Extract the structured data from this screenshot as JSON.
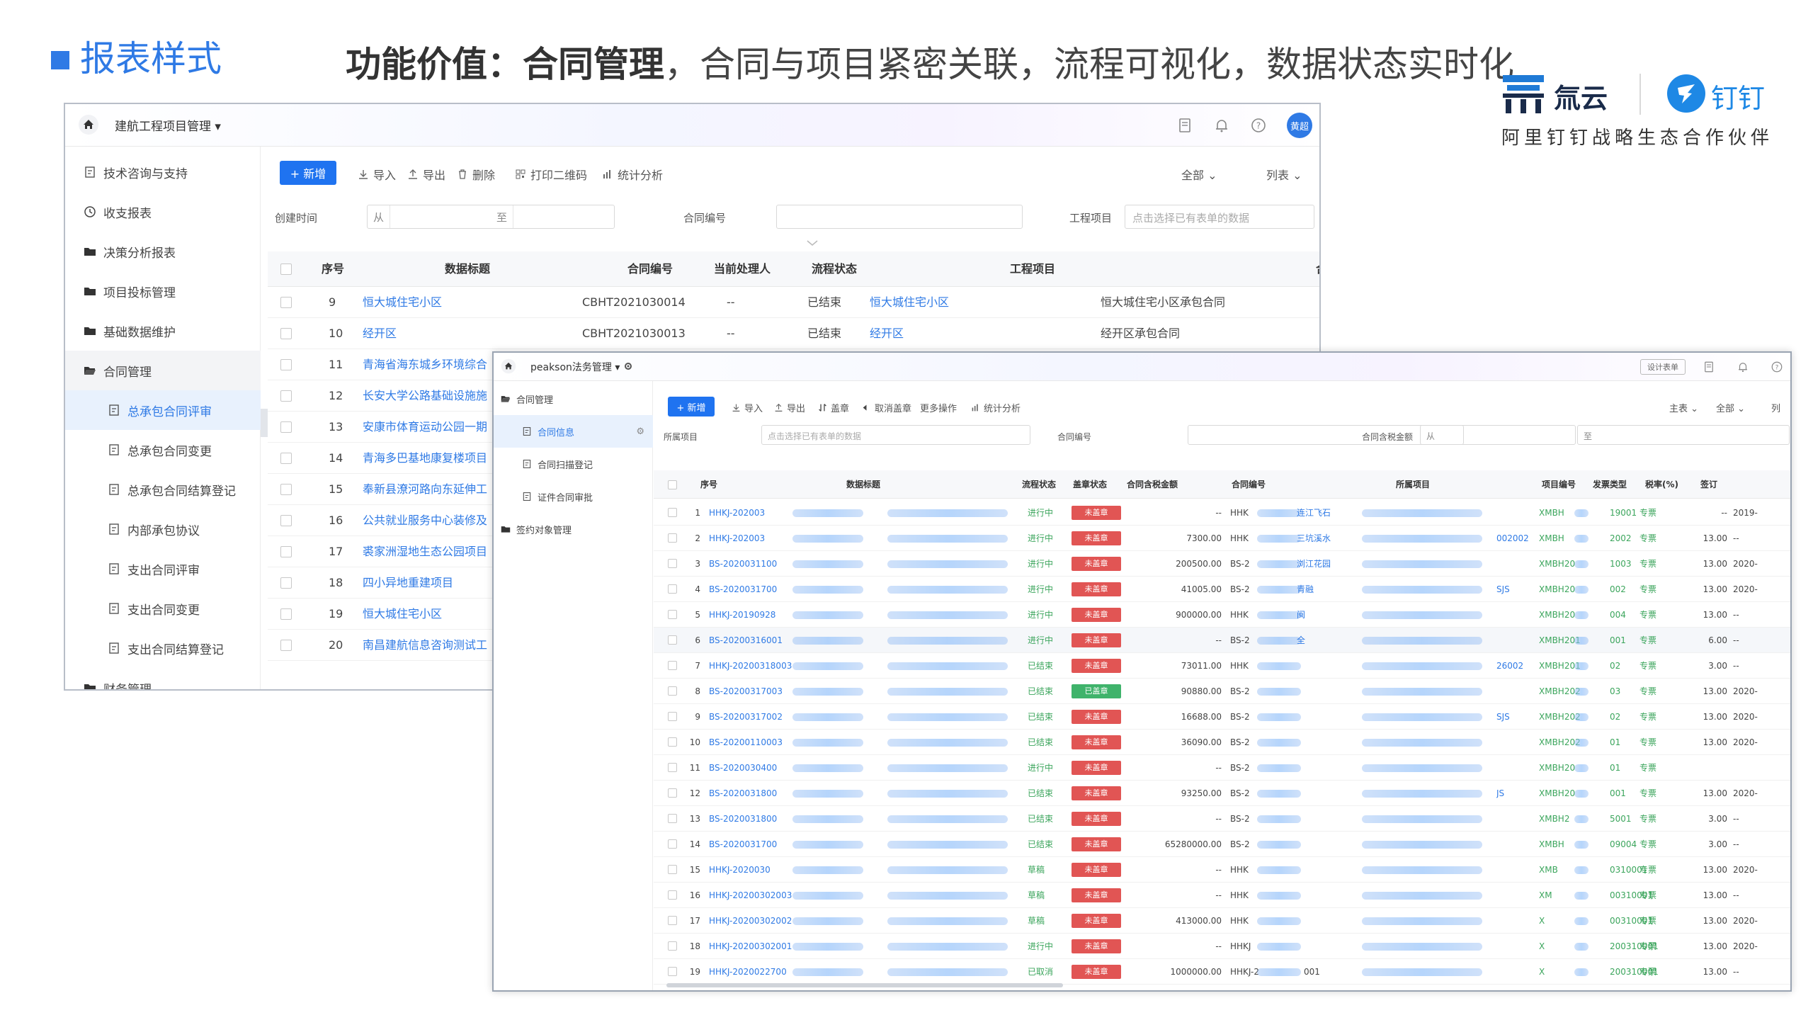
{
  "slide": {
    "title": "报表样式",
    "function_prefix": "功能价值：",
    "function_topic": "合同管理",
    "function_desc": "，合同与项目紧密关联，流程可视化，数据状态实时化",
    "logo_qi": "氚云",
    "logo_ding": "钉钉",
    "partner": "阿里钉钉战略生态合作伙伴",
    "accent_color": "#2f7ae5"
  },
  "win1": {
    "app_title": "建航工程项目管理 ▾",
    "avatar": "黄超",
    "sidebar": [
      {
        "label": "技术咨询与支持",
        "icon": "form-icon"
      },
      {
        "label": "收支报表",
        "icon": "clock-icon"
      },
      {
        "label": "决策分析报表",
        "icon": "folder-icon"
      },
      {
        "label": "项目投标管理",
        "icon": "folder-icon"
      },
      {
        "label": "基础数据维护",
        "icon": "folder-icon"
      },
      {
        "label": "合同管理",
        "icon": "folder-open-icon"
      },
      {
        "label": "总承包合同评审",
        "icon": "form-icon"
      },
      {
        "label": "总承包合同变更",
        "icon": "form-icon"
      },
      {
        "label": "总承包合同结算登记",
        "icon": "form-icon"
      },
      {
        "label": "内部承包协议",
        "icon": "form-icon"
      },
      {
        "label": "支出合同评审",
        "icon": "form-icon"
      },
      {
        "label": "支出合同变更",
        "icon": "form-icon"
      },
      {
        "label": "支出合同结算登记",
        "icon": "form-icon"
      },
      {
        "label": "财务管理",
        "icon": "folder-icon"
      }
    ],
    "toolbar": {
      "add": "+ 新增",
      "import": "导入",
      "export": "导出",
      "delete": "删除",
      "print_qr": "打印二维码",
      "stats": "统计分析",
      "filter_all": "全部 ⌄",
      "view_list": "列表 ⌄"
    },
    "filters": {
      "created_label": "创建时间",
      "from": "从",
      "to": "至",
      "contract_no_label": "合同编号",
      "project_label": "工程项目",
      "project_placeholder": "点击选择已有表单的数据"
    },
    "columns": [
      "序号",
      "数据标题",
      "合同编号",
      "当前处理人",
      "流程状态",
      "工程项目",
      "合同名称"
    ],
    "rows": [
      {
        "no": "9",
        "title": "恒大城住宅小区",
        "code": "CBHT2021030014",
        "handler": "--",
        "status": "已结束",
        "project": "恒大城住宅小区",
        "name": "恒大城住宅小区承包合同"
      },
      {
        "no": "10",
        "title": "经开区",
        "code": "CBHT2021030013",
        "handler": "--",
        "status": "已结束",
        "project": "经开区",
        "name": "经开区承包合同"
      },
      {
        "no": "11",
        "title": "青海省海东城乡环境综合"
      },
      {
        "no": "12",
        "title": "长安大学公路基础设施施"
      },
      {
        "no": "13",
        "title": "安康市体育运动公园一期"
      },
      {
        "no": "14",
        "title": "青海多巴基地康复楼项目"
      },
      {
        "no": "15",
        "title": "奉新县潦河路向东延伸工"
      },
      {
        "no": "16",
        "title": "公共就业服务中心装修及"
      },
      {
        "no": "17",
        "title": "裘家洲湿地生态公园项目"
      },
      {
        "no": "18",
        "title": "四小异地重建项目"
      },
      {
        "no": "19",
        "title": "恒大城住宅小区"
      },
      {
        "no": "20",
        "title": "南昌建航信息咨询测试工"
      }
    ]
  },
  "win2": {
    "app_title": "peakson法务管理 ▾",
    "design_btn": "设计表单",
    "sidebar": [
      {
        "label": "合同管理",
        "icon": "folder-open-icon"
      },
      {
        "label": "合同信息",
        "icon": "form-icon"
      },
      {
        "label": "合同扫描登记",
        "icon": "form-icon"
      },
      {
        "label": "证件合同审批",
        "icon": "form-icon"
      },
      {
        "label": "签约对象管理",
        "icon": "folder-icon"
      }
    ],
    "toolbar": {
      "add": "+ 新增",
      "import": "导入",
      "export": "导出",
      "seal": "盖章",
      "cancel_seal": "取消盖章",
      "more": "更多操作",
      "stats": "统计分析",
      "filter_main": "主表 ⌄",
      "filter_all": "全部 ⌄",
      "view_list": "列"
    },
    "filters": {
      "project_label": "所属项目",
      "project_placeholder": "点击选择已有表单的数据",
      "contract_no_label": "合同编号",
      "amount_label": "合同含税金额",
      "from": "从",
      "to": "至"
    },
    "columns": [
      "序号",
      "数据标题",
      "流程状态",
      "盖章状态",
      "合同含税金额",
      "合同编号",
      "所属项目",
      "项目编号",
      "发票类型",
      "税率(%)",
      "签订"
    ],
    "rows": [
      {
        "no": "1",
        "title": "HHKJ-202003",
        "status": "进行中",
        "seal": "未盖章",
        "amount": "--",
        "code": "HHK",
        "project": "连江飞石",
        "pcode": "XMBH",
        "pcode_tail": "19001",
        "invoice": "专票",
        "tax": "--",
        "sign": "2019-"
      },
      {
        "no": "2",
        "title": "HHKJ-202003",
        "status": "进行中",
        "seal": "未盖章",
        "amount": "7300.00",
        "code": "HHK",
        "project": "三坑溪水",
        "project_tail": "002002",
        "pcode": "XMBH",
        "pcode_tail": "2002",
        "invoice": "专票",
        "tax": "13.00",
        "sign": "--"
      },
      {
        "no": "3",
        "title": "BS-2020031100",
        "status": "进行中",
        "seal": "未盖章",
        "amount": "200500.00",
        "code": "BS-2",
        "project": "浏江花园",
        "pcode": "XMBH20",
        "pcode_tail": "1003",
        "invoice": "专票",
        "tax": "13.00",
        "sign": "2020-"
      },
      {
        "no": "4",
        "title": "BS-2020031700",
        "status": "进行中",
        "seal": "未盖章",
        "amount": "41005.00",
        "code": "BS-2",
        "project": "青融",
        "project_tail": "SJS",
        "pcode": "XMBH20",
        "pcode_tail": "002",
        "invoice": "专票",
        "tax": "13.00",
        "sign": "2020-"
      },
      {
        "no": "5",
        "title": "HHKJ-20190928",
        "status": "进行中",
        "seal": "未盖章",
        "amount": "900000.00",
        "code": "HHK",
        "project": "闽",
        "pcode": "XMBH20",
        "pcode_tail": "004",
        "invoice": "专票",
        "tax": "13.00",
        "sign": "--"
      },
      {
        "no": "6",
        "title": "BS-20200316001",
        "status": "进行中",
        "seal": "未盖章",
        "amount": "--",
        "code": "BS-2",
        "project": "全",
        "pcode": "XMBH201",
        "pcode_tail": "001",
        "invoice": "专票",
        "tax": "6.00",
        "sign": "--"
      },
      {
        "no": "7",
        "title": "HHKJ-20200318003",
        "status": "已结束",
        "seal": "未盖章",
        "amount": "73011.00",
        "code": "HHK",
        "project": "",
        "project_tail": "26002",
        "pcode": "XMBH201",
        "pcode_tail": "02",
        "invoice": "专票",
        "tax": "3.00",
        "sign": "--"
      },
      {
        "no": "8",
        "title": "BS-20200317003",
        "status": "已结束",
        "seal": "已盖章",
        "amount": "90880.00",
        "code": "BS-2",
        "project": "",
        "pcode": "XMBH202",
        "pcode_tail": "03",
        "invoice": "专票",
        "tax": "13.00",
        "sign": "2020-"
      },
      {
        "no": "9",
        "title": "BS-20200317002",
        "status": "已结束",
        "seal": "未盖章",
        "amount": "16688.00",
        "code": "BS-2",
        "project": "",
        "project_tail": "SJS",
        "pcode": "XMBH202",
        "pcode_tail": "02",
        "invoice": "专票",
        "tax": "13.00",
        "sign": "2020-"
      },
      {
        "no": "10",
        "title": "BS-20200110003",
        "status": "已结束",
        "seal": "未盖章",
        "amount": "36090.00",
        "code": "BS-2",
        "project": "",
        "pcode": "XMBH202",
        "pcode_tail": "01",
        "invoice": "专票",
        "tax": "13.00",
        "sign": "2020-"
      },
      {
        "no": "11",
        "title": "BS-2020030400",
        "status": "进行中",
        "seal": "未盖章",
        "amount": "--",
        "code": "BS-2",
        "project": "",
        "pcode": "XMBH20",
        "pcode_tail": "01",
        "invoice": "专票",
        "tax": "",
        "sign": ""
      },
      {
        "no": "12",
        "title": "BS-2020031800",
        "status": "已结束",
        "seal": "未盖章",
        "amount": "93250.00",
        "code": "BS-2",
        "project": "",
        "project_tail": "JS",
        "pcode": "XMBH20",
        "pcode_tail": "001",
        "invoice": "专票",
        "tax": "13.00",
        "sign": "2020-"
      },
      {
        "no": "13",
        "title": "BS-2020031800",
        "status": "已结束",
        "seal": "未盖章",
        "amount": "--",
        "code": "BS-2",
        "project": "",
        "pcode": "XMBH2",
        "pcode_tail": "5001",
        "invoice": "专票",
        "tax": "3.00",
        "sign": "--"
      },
      {
        "no": "14",
        "title": "BS-2020031700",
        "status": "已结束",
        "seal": "未盖章",
        "amount": "65280000.00",
        "code": "BS-2",
        "project": "",
        "pcode": "XMBH",
        "pcode_tail": "09004",
        "invoice": "专票",
        "tax": "3.00",
        "sign": "--"
      },
      {
        "no": "15",
        "title": "HHKJ-2020030",
        "status": "草稿",
        "seal": "未盖章",
        "amount": "--",
        "code": "HHK",
        "project": "",
        "pcode": "XMB",
        "pcode_tail": "0310001",
        "invoice": "专票",
        "tax": "13.00",
        "sign": "2020-"
      },
      {
        "no": "16",
        "title": "HHKJ-20200302003",
        "status": "草稿",
        "seal": "未盖章",
        "amount": "--",
        "code": "HHK",
        "project": "",
        "pcode": "XM",
        "pcode_tail": "00310001",
        "invoice": "专票",
        "tax": "13.00",
        "sign": "--"
      },
      {
        "no": "17",
        "title": "HHKJ-20200302002",
        "status": "草稿",
        "seal": "未盖章",
        "amount": "413000.00",
        "code": "HHK",
        "project": "",
        "pcode": "X",
        "pcode_tail": "00310001",
        "invoice": "专票",
        "tax": "13.00",
        "sign": "2020-"
      },
      {
        "no": "18",
        "title": "HHKJ-20200302001",
        "status": "进行中",
        "seal": "未盖章",
        "amount": "--",
        "code": "HHKJ",
        "project": "",
        "pcode": "X",
        "pcode_tail": "200310001",
        "invoice": "专票",
        "tax": "13.00",
        "sign": "2020-"
      },
      {
        "no": "19",
        "title": "HHKJ-2020022700",
        "status": "已取消",
        "seal": "未盖章",
        "amount": "1000000.00",
        "code": "HHKJ-2",
        "code_tail": "001",
        "project": "",
        "pcode": "X",
        "pcode_tail": "200310001",
        "invoice": "专票",
        "tax": "13.00",
        "sign": "--"
      }
    ]
  }
}
